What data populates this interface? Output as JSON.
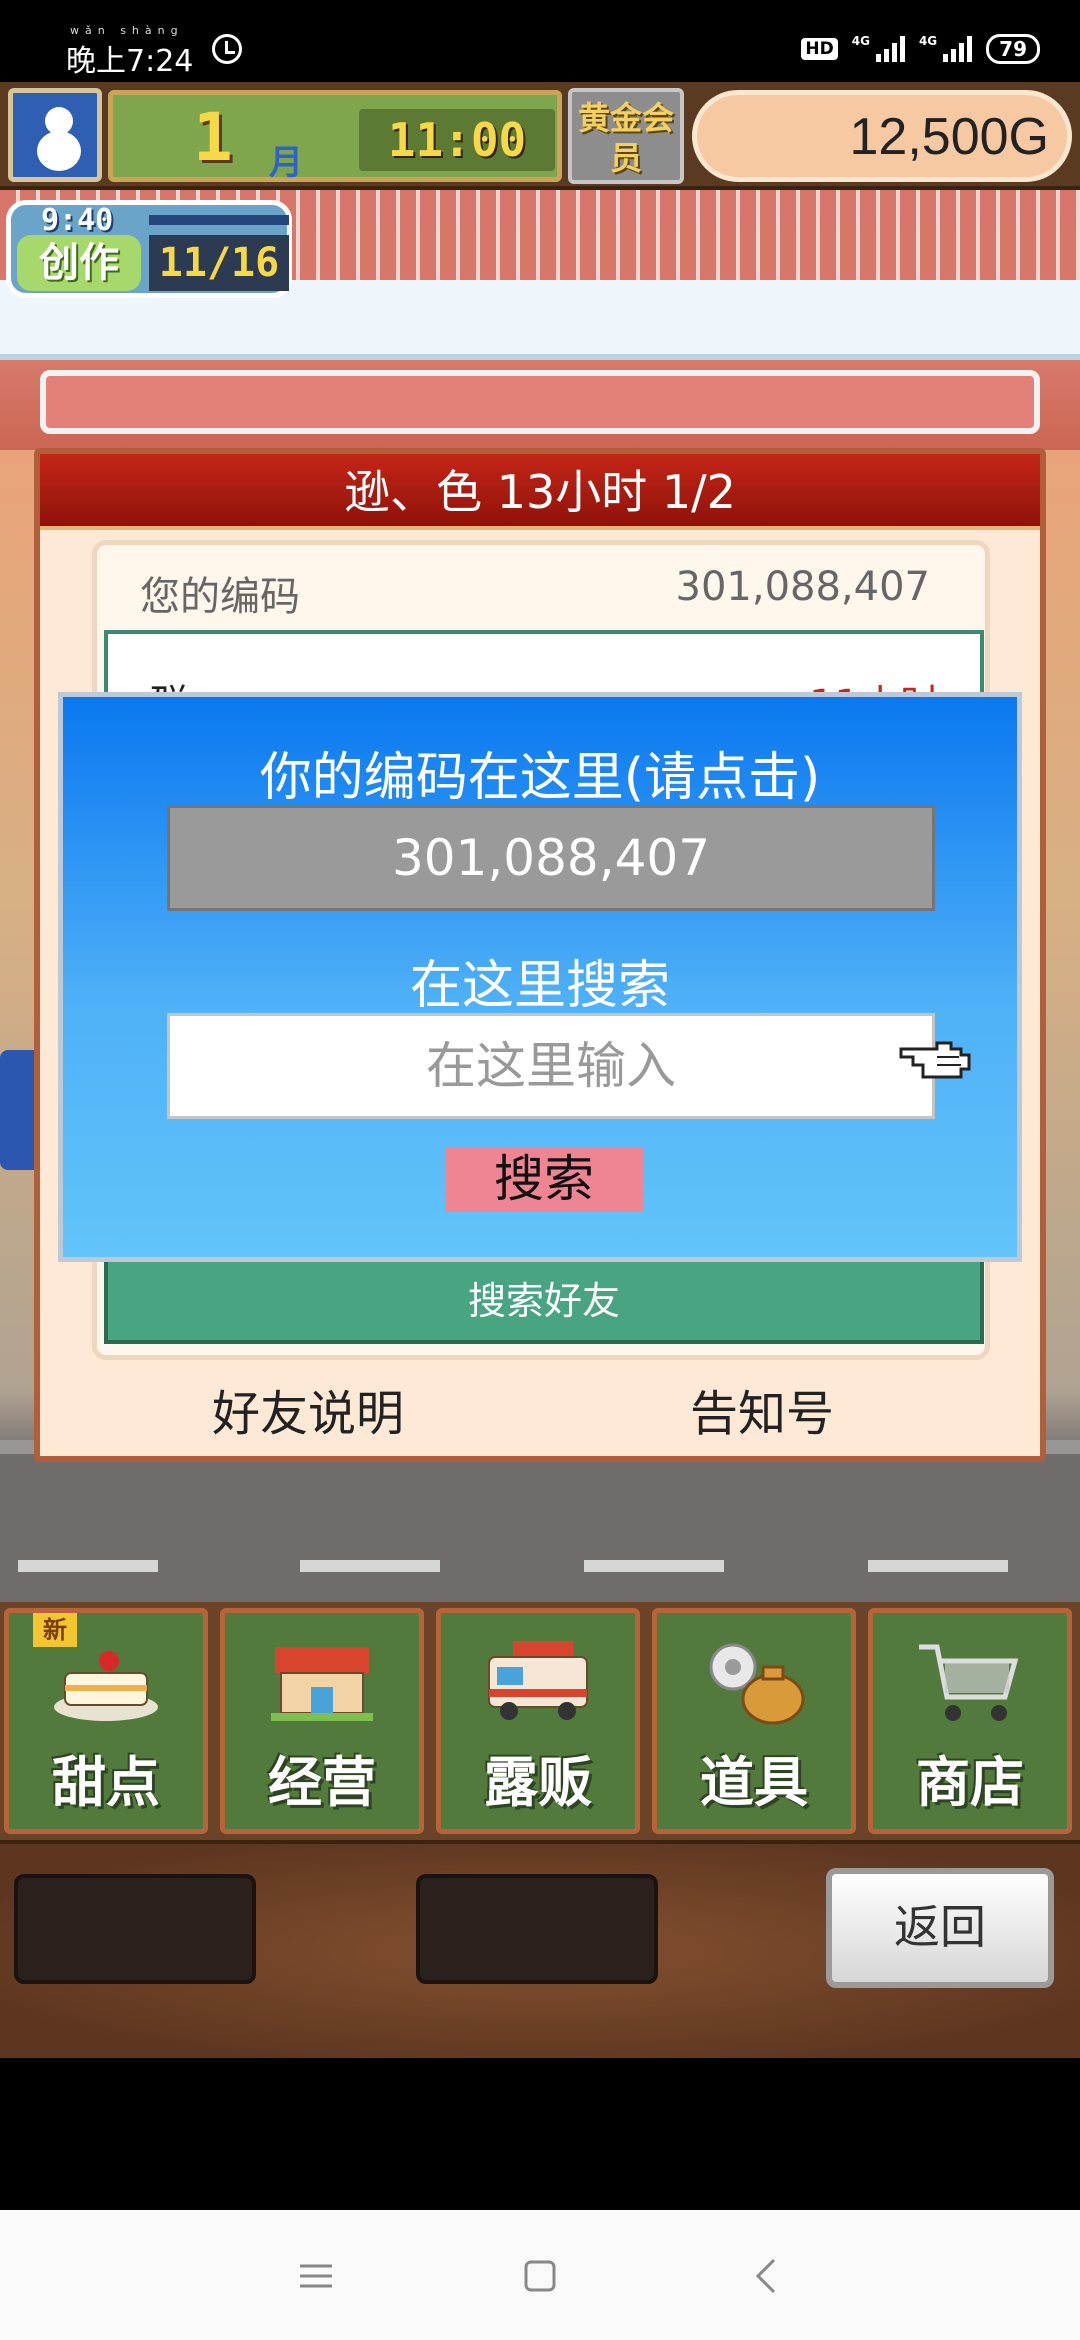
{
  "status_bar": {
    "time": "晚上7:24",
    "time_ruby": "wǎn shàng",
    "hd": "HD",
    "net1": "4G",
    "net2": "4G",
    "battery": "79"
  },
  "top_bar": {
    "month_num": "1",
    "month_unit": "月",
    "clock": "11:00",
    "gold_member": "黄金会员",
    "money": "12,500G"
  },
  "creation": {
    "time": "9:40",
    "label": "创作",
    "progress": "11/16"
  },
  "friend_panel": {
    "title": "逊、色  13小时 1/2",
    "code_label": "您的编码",
    "code_value": "301,088,407",
    "list_peek_left": "群",
    "list_peek_right": "11小时",
    "search_friend_label": "搜索好友",
    "friend_help": "好友说明",
    "notice_id": "告知号"
  },
  "search_dialog": {
    "title": "你的编码在这里(请点击)",
    "code": "301,088,407",
    "search_label": "在这里搜索",
    "input_placeholder": "在这里输入",
    "input_value": "",
    "search_button": "搜索"
  },
  "menu": {
    "items": [
      {
        "label": "甜点",
        "icon": "cake-icon",
        "badge": "新"
      },
      {
        "label": "经营",
        "icon": "shop-icon"
      },
      {
        "label": "露贩",
        "icon": "food-truck-icon"
      },
      {
        "label": "道具",
        "icon": "items-bag-icon"
      },
      {
        "label": "商店",
        "icon": "shopping-cart-icon"
      }
    ],
    "back_button": "返回"
  },
  "colors": {
    "dialog_blue": "#0a78f0",
    "title_red": "#c42617",
    "search_button": "#ef8593",
    "menu_green": "#527a3d"
  }
}
